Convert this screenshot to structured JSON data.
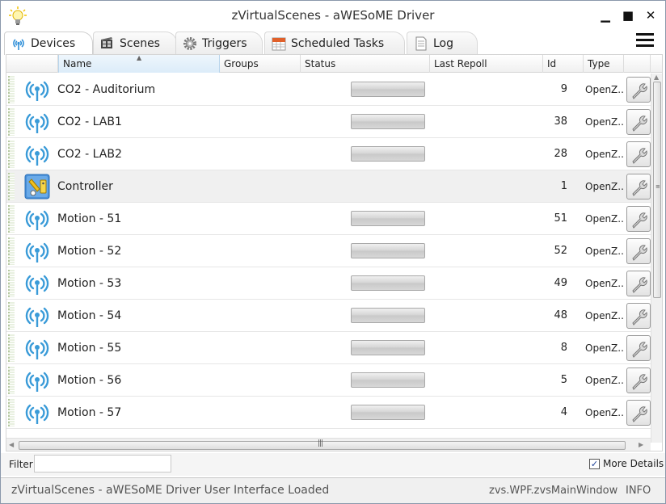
{
  "window": {
    "title": "zVirtualScenes - aWESoME Driver",
    "minimize_glyph": "▁",
    "maximize_glyph": "■",
    "close_glyph": "✕",
    "app_icon": "lightbulb-icon"
  },
  "tabs": [
    {
      "label": "Devices",
      "icon": "antenna-icon",
      "active": true
    },
    {
      "label": "Scenes",
      "icon": "film-icon",
      "active": false
    },
    {
      "label": "Triggers",
      "icon": "gear-icon",
      "active": false
    },
    {
      "label": "Scheduled Tasks",
      "icon": "calendar-icon",
      "active": false
    },
    {
      "label": "Log",
      "icon": "document-icon",
      "active": false
    }
  ],
  "grid": {
    "columns": [
      "Name",
      "Groups",
      "Status",
      "Last Repoll",
      "Id",
      "Type"
    ],
    "sorted_column": "Name",
    "rows": [
      {
        "name": "CO2 - Auditorium",
        "id": "9",
        "type": "OpenZ...",
        "icon": "wireless-sensor-icon",
        "has_status_bar": true,
        "selected": false
      },
      {
        "name": "CO2 - LAB1",
        "id": "38",
        "type": "OpenZ...",
        "icon": "wireless-sensor-icon",
        "has_status_bar": true,
        "selected": false
      },
      {
        "name": "CO2 - LAB2",
        "id": "28",
        "type": "OpenZ...",
        "icon": "wireless-sensor-icon",
        "has_status_bar": true,
        "selected": false
      },
      {
        "name": "Controller",
        "id": "1",
        "type": "OpenZ...",
        "icon": "controller-icon",
        "has_status_bar": false,
        "selected": true
      },
      {
        "name": "Motion - 51",
        "id": "51",
        "type": "OpenZ...",
        "icon": "wireless-sensor-icon",
        "has_status_bar": true,
        "selected": false
      },
      {
        "name": "Motion - 52",
        "id": "52",
        "type": "OpenZ...",
        "icon": "wireless-sensor-icon",
        "has_status_bar": true,
        "selected": false
      },
      {
        "name": "Motion - 53",
        "id": "49",
        "type": "OpenZ...",
        "icon": "wireless-sensor-icon",
        "has_status_bar": true,
        "selected": false
      },
      {
        "name": "Motion - 54",
        "id": "48",
        "type": "OpenZ...",
        "icon": "wireless-sensor-icon",
        "has_status_bar": true,
        "selected": false
      },
      {
        "name": "Motion - 55",
        "id": "8",
        "type": "OpenZ...",
        "icon": "wireless-sensor-icon",
        "has_status_bar": true,
        "selected": false
      },
      {
        "name": "Motion - 56",
        "id": "5",
        "type": "OpenZ...",
        "icon": "wireless-sensor-icon",
        "has_status_bar": true,
        "selected": false
      },
      {
        "name": "Motion - 57",
        "id": "4",
        "type": "OpenZ...",
        "icon": "wireless-sensor-icon",
        "has_status_bar": true,
        "selected": false
      }
    ]
  },
  "filter": {
    "label": "Filter",
    "value": ""
  },
  "more_details": {
    "label": "More Details",
    "checked": true
  },
  "statusbar": {
    "message": "zVirtualScenes - aWESoME Driver User Interface Loaded",
    "source": "zvs.WPF.zvsMainWindow",
    "level": "INFO"
  },
  "colors": {
    "accent": "#2f8fd8",
    "selected_row": "#f0f0f0"
  }
}
